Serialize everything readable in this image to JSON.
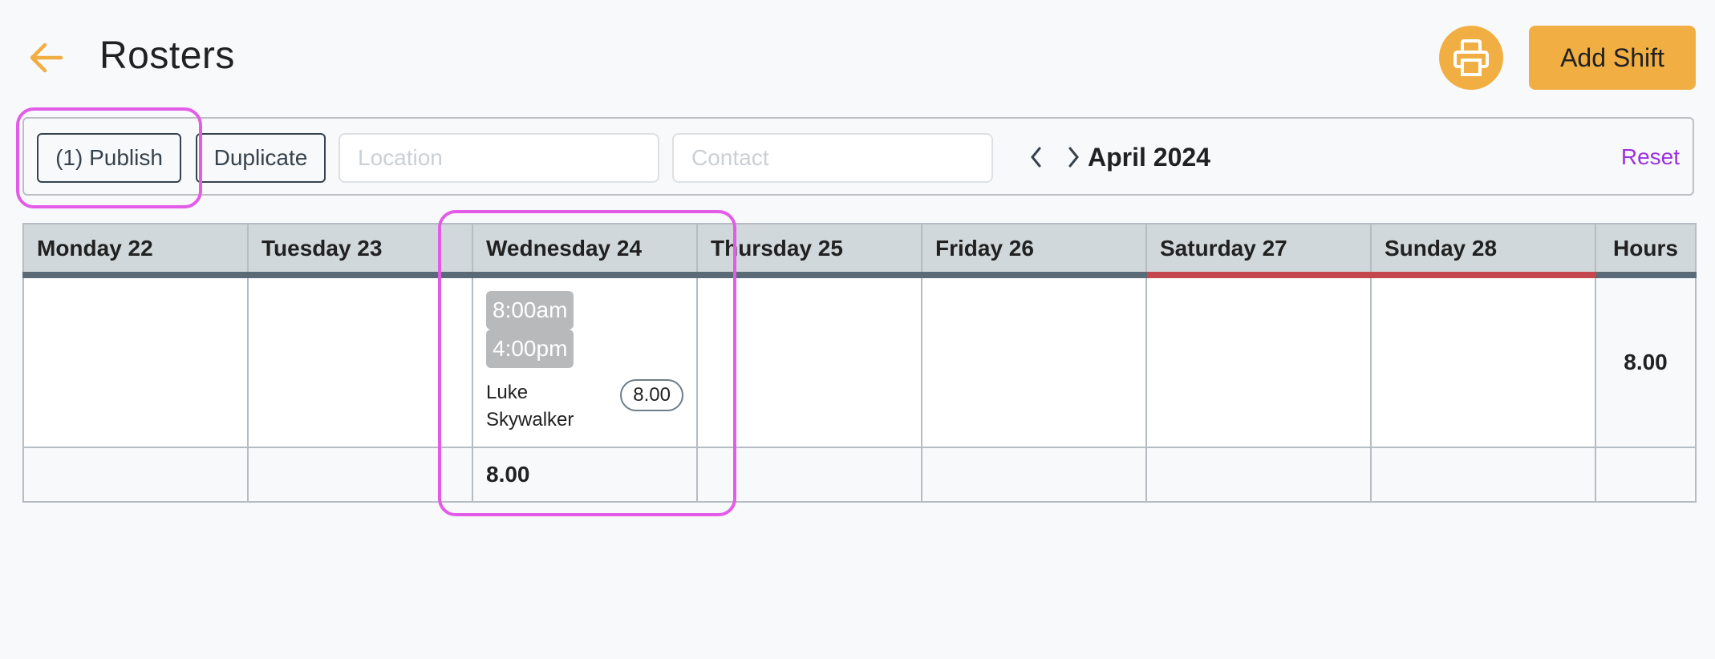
{
  "header": {
    "title": "Rosters",
    "back_icon": "arrow-left-icon",
    "print_icon": "printer-icon",
    "add_shift_label": "Add Shift"
  },
  "toolbar": {
    "publish_label": "(1) Publish",
    "duplicate_label": "Duplicate",
    "location_placeholder": "Location",
    "location_value": "",
    "contact_placeholder": "Contact",
    "contact_value": "",
    "prev_icon": "chevron-left-icon",
    "next_icon": "chevron-right-icon",
    "month": "April 2024",
    "reset_label": "Reset"
  },
  "roster": {
    "columns": [
      {
        "label": "Monday 22",
        "weekend": false
      },
      {
        "label": "Tuesday 23",
        "weekend": false
      },
      {
        "label": "Wednesday 24",
        "weekend": false
      },
      {
        "label": "Thursday 25",
        "weekend": false
      },
      {
        "label": "Friday 26",
        "weekend": false
      },
      {
        "label": "Saturday 27",
        "weekend": true
      },
      {
        "label": "Sunday 28",
        "weekend": true
      }
    ],
    "hours_header": "Hours",
    "shift": {
      "day": "Wednesday 24",
      "start": "8:00am",
      "end": "4:00pm",
      "staff": "Luke Skywalker",
      "hours": "8.00"
    },
    "row_hours": "8.00",
    "daily_totals": [
      "",
      "",
      "8.00",
      "",
      "",
      "",
      ""
    ],
    "total_hours": ""
  },
  "colors": {
    "accent": "#f1af43",
    "reset_link": "#9b32e0",
    "weekday_underline": "#5a6b77",
    "weekend_underline": "#c4474d",
    "highlight": "#e35ce8"
  }
}
